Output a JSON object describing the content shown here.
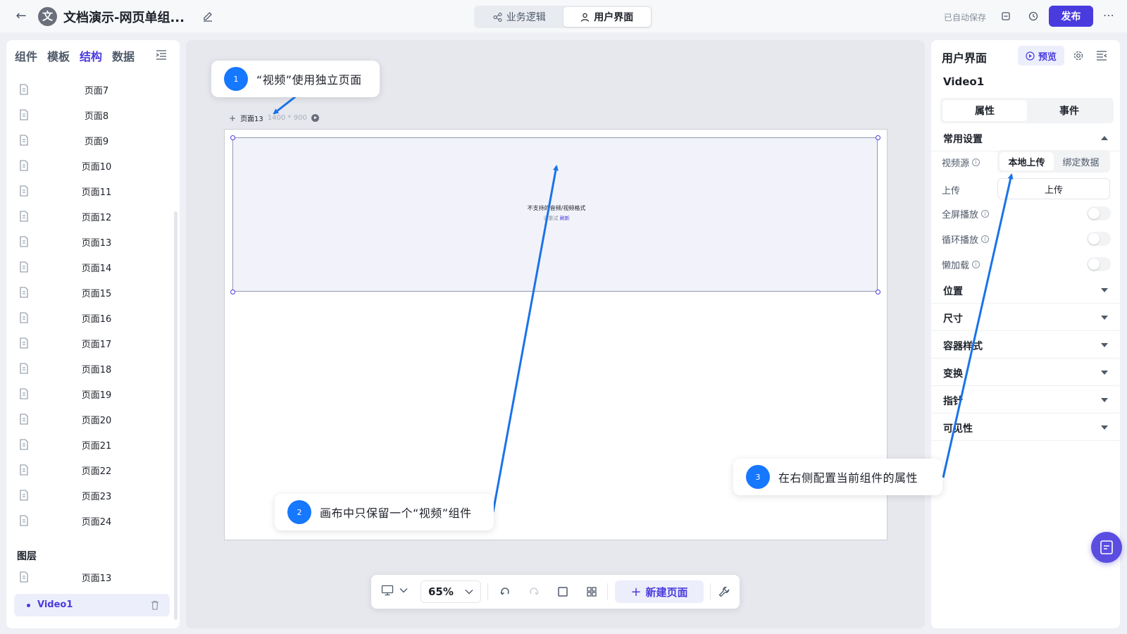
{
  "topbar": {
    "avatar_char": "文",
    "title": "文档演示-网页单组...",
    "tabs": [
      {
        "label": "业务逻辑",
        "icon": "flow-icon"
      },
      {
        "label": "用户界面",
        "icon": "user-icon"
      }
    ],
    "autosave": "已自动保存",
    "publish": "发布"
  },
  "left_panel": {
    "tabs": [
      "组件",
      "模板",
      "结构",
      "数据"
    ],
    "active_tab": "结构",
    "pages": [
      "页面7",
      "页面8",
      "页面9",
      "页面10",
      "页面11",
      "页面12",
      "页面13",
      "页面14",
      "页面15",
      "页面16",
      "页面17",
      "页面18",
      "页面19",
      "页面20",
      "页面21",
      "页面22",
      "页面23",
      "页面24"
    ],
    "layers_title": "图层",
    "layer_page": "页面13",
    "layer_component": "Video1"
  },
  "canvas": {
    "page_name": "页面13",
    "page_size": "1400 * 900",
    "video_message": "不支持的音频/视频格式",
    "retry_prefix": "请重试",
    "retry_link": "刷新"
  },
  "bottom_toolbar": {
    "zoom": "65%",
    "new_page": "新建页面"
  },
  "right_panel": {
    "title": "用户界面",
    "preview": "预览",
    "component_name": "Video1",
    "tabs": [
      "属性",
      "事件"
    ],
    "common_section": "常用设置",
    "video_source_label": "视频源",
    "video_source_options": [
      "本地上传",
      "绑定数据"
    ],
    "upload_label": "上传",
    "upload_button": "上传",
    "fullscreen_label": "全屏播放",
    "loop_label": "循环播放",
    "lazy_label": "懒加载",
    "sections": [
      "位置",
      "尺寸",
      "容器样式",
      "变换",
      "指针",
      "可见性"
    ]
  },
  "callouts": [
    {
      "num": "1",
      "text": "“视频”使用独立页面"
    },
    {
      "num": "2",
      "text": "画布中只保留一个“视频”组件"
    },
    {
      "num": "3",
      "text": "在右侧配置当前组件的属性"
    }
  ],
  "colors": {
    "accent": "#4a3bde",
    "callout_blue": "#1677ff",
    "arrow_blue": "#1a73e8"
  }
}
